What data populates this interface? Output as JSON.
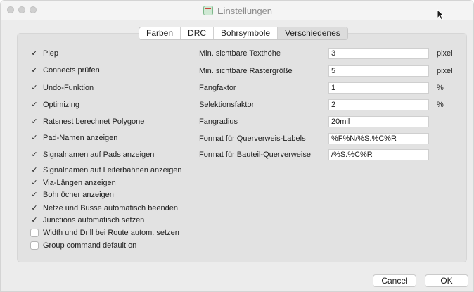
{
  "window": {
    "title": "Einstellungen"
  },
  "tabs": [
    {
      "label": "Farben",
      "active": false
    },
    {
      "label": "DRC",
      "active": false
    },
    {
      "label": "Bohrsymbole",
      "active": false
    },
    {
      "label": "Verschiedenes",
      "active": true
    }
  ],
  "options": [
    {
      "label": "Piep",
      "checked": true
    },
    {
      "label": "Connects prüfen",
      "checked": true
    },
    {
      "label": "Undo-Funktion",
      "checked": true
    },
    {
      "label": "Optimizing",
      "checked": true
    },
    {
      "label": "Ratsnest berechnet Polygone",
      "checked": true
    },
    {
      "label": "Pad-Namen anzeigen",
      "checked": true
    },
    {
      "label": "Signalnamen auf Pads anzeigen",
      "checked": true
    },
    {
      "label": "Signalnamen auf Leiterbahnen anzeigen",
      "checked": true
    },
    {
      "label": "Via-Längen anzeigen",
      "checked": true
    },
    {
      "label": "Bohrlöcher anzeigen",
      "checked": true
    },
    {
      "label": "Netze und Busse automatisch beenden",
      "checked": true
    },
    {
      "label": "Junctions automatisch setzen",
      "checked": true
    },
    {
      "label": "Width und Drill bei Route autom. setzen",
      "checked": false
    },
    {
      "label": "Group command default on",
      "checked": false
    }
  ],
  "fields": [
    {
      "label": "Min. sichtbare Texthöhe",
      "value": "3",
      "unit": "pixel"
    },
    {
      "label": "Min. sichtbare Rastergröße",
      "value": "5",
      "unit": "pixel"
    },
    {
      "label": "Fangfaktor",
      "value": "1",
      "unit": "%"
    },
    {
      "label": "Selektionsfaktor",
      "value": "2",
      "unit": "%"
    },
    {
      "label": "Fangradius",
      "value": "20mil",
      "unit": ""
    },
    {
      "label": "Format für Querverweis-Labels",
      "value": "%F%N/%S.%C%R",
      "unit": ""
    },
    {
      "label": "Format für Bauteil-Querverweise",
      "value": "/%S.%C%R",
      "unit": ""
    }
  ],
  "buttons": {
    "cancel": "Cancel",
    "ok": "OK"
  }
}
